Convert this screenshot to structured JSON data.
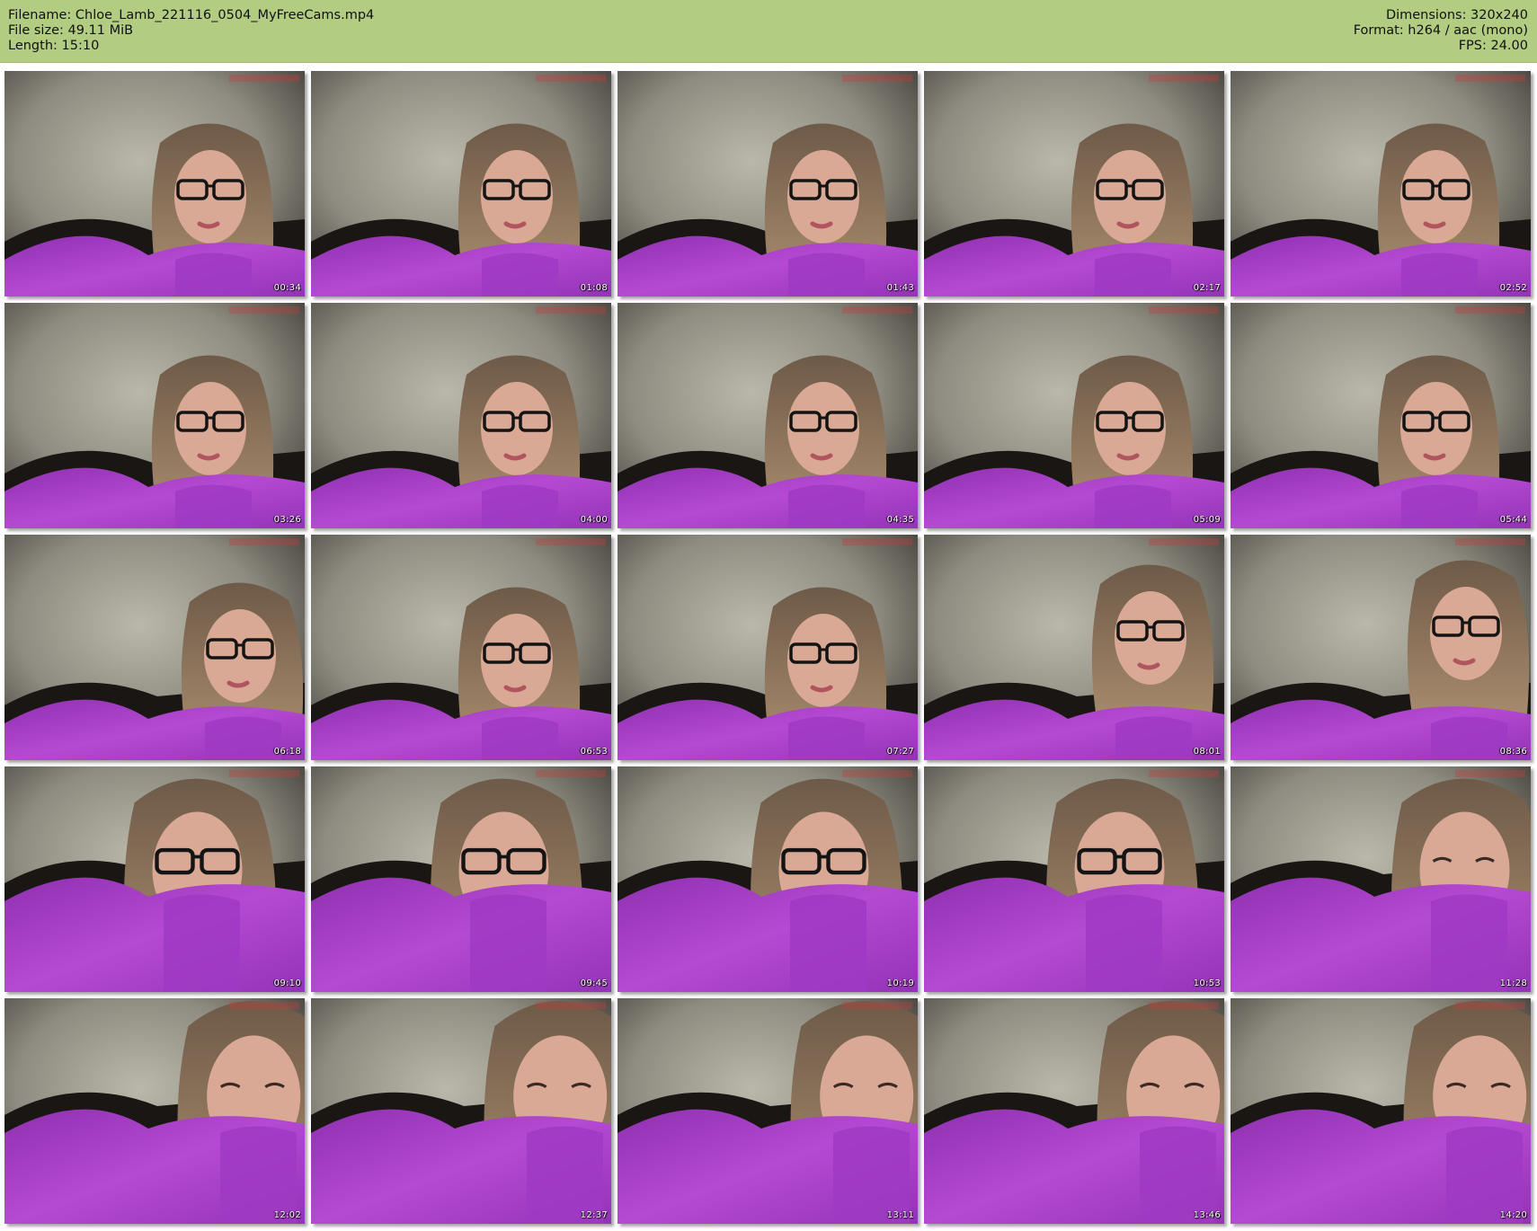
{
  "header": {
    "left": [
      "Filename: Chloe_Lamb_221116_0504_MyFreeCams.mp4",
      "File size: 49.11 MiB",
      "Length: 15:10"
    ],
    "right": [
      "Dimensions: 320x240",
      "Format: h264 / aac (mono)",
      "FPS: 24.00"
    ]
  },
  "colors": {
    "header_bg": "#b2cd82",
    "sweater": "#a83ec6",
    "wall": "#aaa89c"
  },
  "thumbnails": [
    {
      "time": "00:34"
    },
    {
      "time": "01:08"
    },
    {
      "time": "01:43"
    },
    {
      "time": "02:17"
    },
    {
      "time": "02:52"
    },
    {
      "time": "03:26"
    },
    {
      "time": "04:00"
    },
    {
      "time": "04:35"
    },
    {
      "time": "05:09"
    },
    {
      "time": "05:44"
    },
    {
      "time": "06:18"
    },
    {
      "time": "06:53"
    },
    {
      "time": "07:27"
    },
    {
      "time": "08:01"
    },
    {
      "time": "08:36"
    },
    {
      "time": "09:10"
    },
    {
      "time": "09:45"
    },
    {
      "time": "10:19"
    },
    {
      "time": "10:53"
    },
    {
      "time": "11:28"
    },
    {
      "time": "12:02"
    },
    {
      "time": "12:37"
    },
    {
      "time": "13:11"
    },
    {
      "time": "13:46"
    },
    {
      "time": "14:20"
    }
  ]
}
